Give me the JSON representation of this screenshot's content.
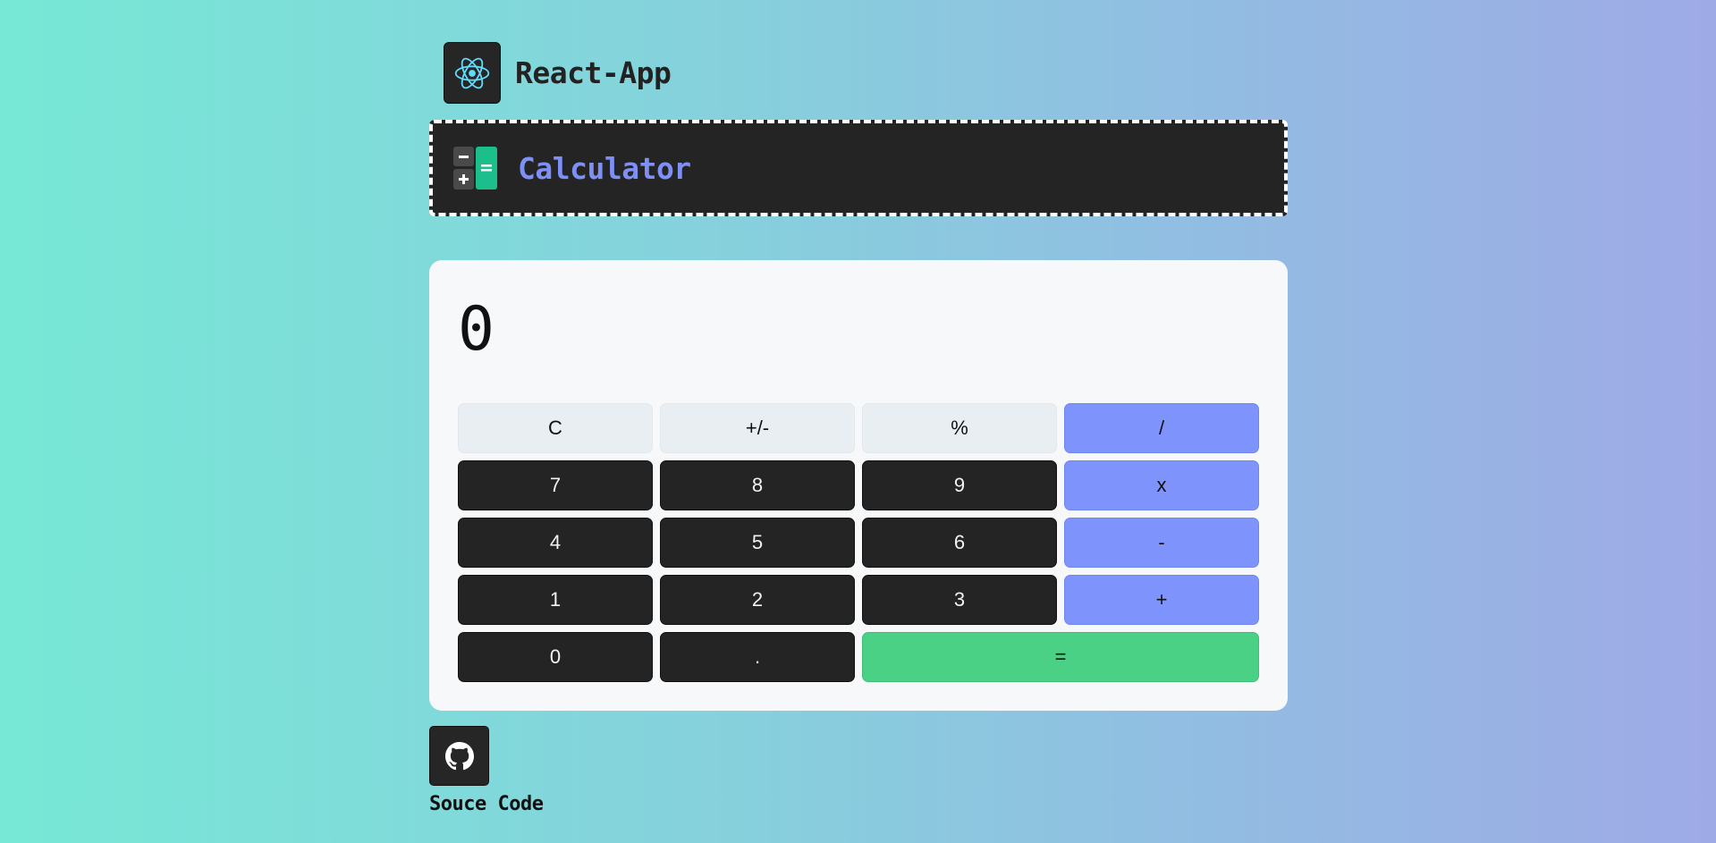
{
  "header": {
    "logo_icon": "react-atom-icon",
    "title": "React-App"
  },
  "banner": {
    "icon": "calculator-icon",
    "title": "Calculator",
    "title_color": "#7f90f5"
  },
  "calculator": {
    "display_value": "0",
    "keys": [
      {
        "label": "C",
        "type": "func",
        "name": "clear-button"
      },
      {
        "label": "+/-",
        "type": "func",
        "name": "sign-toggle-button"
      },
      {
        "label": "%",
        "type": "func",
        "name": "percent-button"
      },
      {
        "label": "/",
        "type": "op",
        "name": "divide-button"
      },
      {
        "label": "7",
        "type": "num",
        "name": "digit-7-button"
      },
      {
        "label": "8",
        "type": "num",
        "name": "digit-8-button"
      },
      {
        "label": "9",
        "type": "num",
        "name": "digit-9-button"
      },
      {
        "label": "x",
        "type": "op",
        "name": "multiply-button"
      },
      {
        "label": "4",
        "type": "num",
        "name": "digit-4-button"
      },
      {
        "label": "5",
        "type": "num",
        "name": "digit-5-button"
      },
      {
        "label": "6",
        "type": "num",
        "name": "digit-6-button"
      },
      {
        "label": "-",
        "type": "op",
        "name": "subtract-button"
      },
      {
        "label": "1",
        "type": "num",
        "name": "digit-1-button"
      },
      {
        "label": "2",
        "type": "num",
        "name": "digit-2-button"
      },
      {
        "label": "3",
        "type": "num",
        "name": "digit-3-button"
      },
      {
        "label": "+",
        "type": "op",
        "name": "add-button"
      },
      {
        "label": "0",
        "type": "num",
        "name": "digit-0-button"
      },
      {
        "label": ".",
        "type": "num",
        "name": "decimal-button"
      },
      {
        "label": "=",
        "type": "eq",
        "name": "equals-button"
      }
    ],
    "colors": {
      "function_key": "#e8eef2",
      "number_key": "#242424",
      "operator_key": "#7f93fc",
      "equals_key": "#4bd185"
    }
  },
  "footer": {
    "github_icon": "github-icon",
    "source_label": "Souce Code"
  }
}
